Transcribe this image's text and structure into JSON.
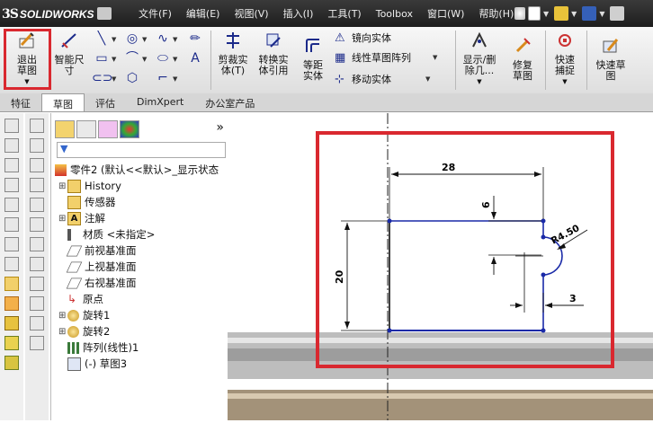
{
  "titlebar": {
    "logo_prefix": "3S",
    "logo_text": "SOLIDWORKS",
    "menu": [
      "文件(F)",
      "编辑(E)",
      "视图(V)",
      "插入(I)",
      "工具(T)",
      "Toolbox",
      "窗口(W)",
      "帮助(H)"
    ]
  },
  "ribbon": {
    "exit_sketch": "退出草图",
    "smart_dim": "智能尺寸",
    "trim": "剪裁实体(T)",
    "convert": "转换实体引用",
    "offset": "等距实体",
    "mirror": "镜向实体",
    "linear_pattern": "线性草图阵列",
    "move": "移动实体",
    "show_delete": "显示/删除几...",
    "repair": "修复草图",
    "quick_snap": "快速捕捉",
    "rapid_sketch": "快速草图"
  },
  "tabs": [
    "特征",
    "草图",
    "评估",
    "DimXpert",
    "办公室产品"
  ],
  "active_tab": "草图",
  "tree": {
    "root": "零件2 (默认<<默认>_显示状态",
    "items": [
      {
        "label": "History",
        "expandable": true
      },
      {
        "label": "传感器",
        "expandable": false
      },
      {
        "label": "注解",
        "expandable": true
      },
      {
        "label": "材质 <未指定>",
        "expandable": false
      },
      {
        "label": "前视基准面",
        "expandable": false
      },
      {
        "label": "上视基准面",
        "expandable": false
      },
      {
        "label": "右视基准面",
        "expandable": false
      },
      {
        "label": "原点",
        "expandable": false
      },
      {
        "label": "旋转1",
        "expandable": true
      },
      {
        "label": "旋转2",
        "expandable": true
      },
      {
        "label": "阵列(线性)1",
        "expandable": false
      },
      {
        "label": "(-) 草图3",
        "expandable": false
      }
    ]
  },
  "sketch": {
    "dim_width": "28",
    "dim_height": "20",
    "dim_6": "6",
    "dim_3": "3",
    "dim_radius": "R4.50"
  },
  "colors": {
    "highlight": "#d9282f",
    "sketch_line": "#1a2aa8",
    "dimension": "#111111"
  }
}
